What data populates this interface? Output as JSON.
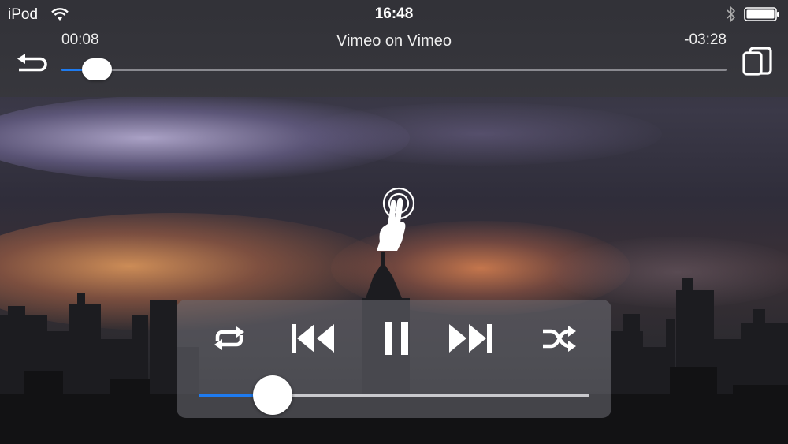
{
  "status_bar": {
    "device": "iPod",
    "time": "16:48"
  },
  "player": {
    "title": "Vimeo on Vimeo",
    "elapsed": "00:08",
    "remaining": "-03:28",
    "progress_fraction": 0.053
  },
  "controls": {
    "icons": [
      "back-icon",
      "mirror-screen-icon",
      "repeat-icon",
      "previous-track-icon",
      "pause-icon",
      "next-track-icon",
      "shuffle-icon",
      "two-finger-tap-icon"
    ],
    "volume_fraction": 0.19
  },
  "colors": {
    "accent": "#1e7bf0",
    "bar": "#323238"
  }
}
